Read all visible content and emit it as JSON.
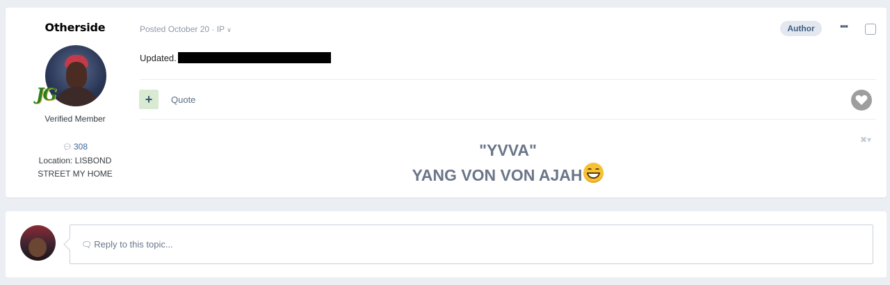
{
  "post": {
    "author": {
      "username": "Otherside",
      "rank_badge": "JG",
      "member_title": "Verified Member",
      "post_count": "308",
      "location_label": "Location: LISBOND",
      "location_value": "STREET MY HOME"
    },
    "meta": {
      "posted": "Posted October 20 · IP",
      "author_badge": "Author",
      "more_icon": "ellipsis-icon"
    },
    "body": {
      "text": "Updated."
    },
    "actions": {
      "reputation_symbol": "+",
      "quote_label": "Quote",
      "react_icon": "heart-icon"
    },
    "signature": {
      "line1": "\"YVVA\"",
      "line2": "YANG VON VON AJAH",
      "emoji": "grinning-face-icon"
    }
  },
  "reply": {
    "placeholder": "Reply to this topic..."
  },
  "colors": {
    "background": "#ebeef2",
    "card": "#ffffff",
    "author_badge_bg": "#e3e8f0",
    "reputation_bg": "#d9ead3",
    "signature_text": "#6a7588"
  }
}
